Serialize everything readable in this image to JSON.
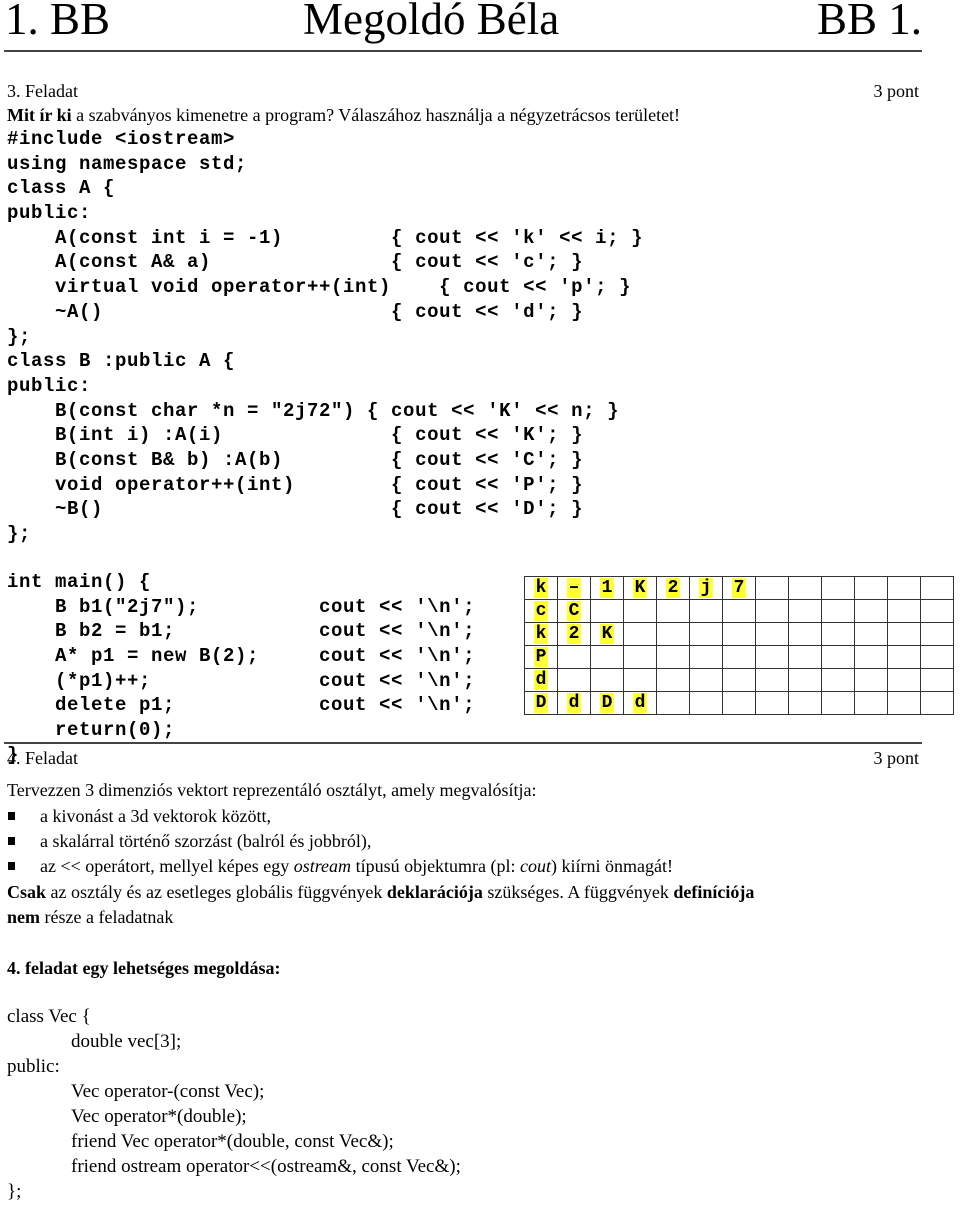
{
  "header": {
    "left": "1. BB",
    "center": "Megoldó Béla",
    "right": "BB 1."
  },
  "task3": {
    "title": "3. Feladat",
    "points": "3 pont",
    "question_bold": "Mit ír ki",
    "question_rest": " a szabványos kimenetre a program? Válaszához használja a négyzetrácsos területet!",
    "code_lines": [
      "#include <iostream>",
      "using namespace std;",
      "class A {",
      "public:",
      "    A(const int i = -1)         { cout << 'k' << i; }",
      "    A(const A& a)               { cout << 'c'; }",
      "    virtual void operator++(int)    { cout << 'p'; }",
      "    ~A()                        { cout << 'd'; }",
      "};",
      "class B :public A {",
      "public:",
      "    B(const char *n = \"2j72\") { cout << 'K' << n; }",
      "    B(int i) :A(i)              { cout << 'K'; }",
      "    B(const B& b) :A(b)         { cout << 'C'; }",
      "    void operator++(int)        { cout << 'P'; }",
      "    ~B()                        { cout << 'D'; }",
      "};"
    ],
    "main_lines": [
      "int main() {",
      "    B b1(\"2j7\");          cout << '\\n';",
      "    B b2 = b1;            cout << '\\n';",
      "    A* p1 = new B(2);     cout << '\\n';",
      "    (*p1)++;              cout << '\\n';",
      "    delete p1;            cout << '\\n';",
      "    return(0);",
      "}"
    ],
    "answer_grid": {
      "columns": 13,
      "rows": [
        [
          "k",
          "–",
          "1",
          "K",
          "2",
          "j",
          "7"
        ],
        [
          "c",
          "C"
        ],
        [
          "k",
          "2",
          "K"
        ],
        [
          "P"
        ],
        [
          "d"
        ],
        [
          "D",
          "d",
          "D",
          "d"
        ]
      ],
      "highlight_color": "#ffff33"
    }
  },
  "task4": {
    "title": "4. Feladat",
    "points": "3 pont",
    "intro": "Tervezzen 3 dimenziós vektort reprezentáló osztályt, amely megvalósítja:",
    "bullets": [
      [
        "a kivonást a 3d vektorok között,"
      ],
      [
        "a skalárral történő szorzást (balról és jobbról),"
      ]
    ],
    "bullet3": {
      "a": "az << operátort, mellyel képes egy ",
      "b_italic": "ostream",
      "c": " típusú objektumra (pl: ",
      "d_italic": "cout",
      "e": ") kiírni önmagát!"
    },
    "note": {
      "b1": "Csak",
      "t1": " az osztály és az esetleges globális függvények ",
      "b2": "deklarációja",
      "t2": " szükséges. A függvények ",
      "b3": "definíciója",
      "b4": "nem",
      "t3": " része a feladatnak"
    },
    "solution_title": "4. feladat egy lehetséges megoldása:",
    "solution_lines": [
      {
        "text": "class Vec {",
        "indent": false
      },
      {
        "text": "double vec[3];",
        "indent": true
      },
      {
        "text": "public:",
        "indent": false
      },
      {
        "text": "Vec operator-(const Vec);",
        "indent": true
      },
      {
        "text": "Vec operator*(double);",
        "indent": true
      },
      {
        "text": "friend Vec operator*(double, const Vec&);",
        "indent": true
      },
      {
        "text": "friend ostream operator<<(ostream&, const Vec&);",
        "indent": true
      },
      {
        "text": "};",
        "indent": false
      }
    ]
  }
}
